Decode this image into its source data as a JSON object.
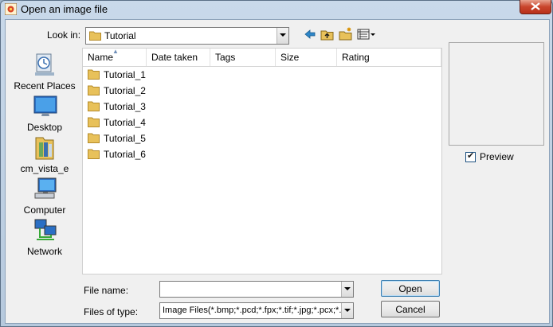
{
  "window": {
    "title": "Open an image file"
  },
  "look_in": {
    "label": "Look in:",
    "value": "Tutorial"
  },
  "toolbar_icons": [
    "back-arrow-icon",
    "up-folder-icon",
    "new-folder-icon",
    "view-menu-icon"
  ],
  "places": [
    {
      "label": "Recent Places",
      "icon": "recent-places-icon"
    },
    {
      "label": "Desktop",
      "icon": "desktop-icon"
    },
    {
      "label": "cm_vista_e",
      "icon": "user-folder-icon"
    },
    {
      "label": "Computer",
      "icon": "computer-icon"
    },
    {
      "label": "Network",
      "icon": "network-icon"
    }
  ],
  "columns": [
    "Name",
    "Date taken",
    "Tags",
    "Size",
    "Rating"
  ],
  "files": [
    "Tutorial_1",
    "Tutorial_2",
    "Tutorial_3",
    "Tutorial_4",
    "Tutorial_5",
    "Tutorial_6"
  ],
  "preview": {
    "label": "Preview",
    "checked": true
  },
  "file_name": {
    "label": "File name:",
    "value": ""
  },
  "files_of_type": {
    "label": "Files of type:",
    "value": "Image Files(*.bmp;*.pcd;*.fpx;*.tif;*.jpg;*.pcx;*.w"
  },
  "buttons": {
    "open": "Open",
    "cancel": "Cancel"
  },
  "colors": {
    "folder": "#e8c15a",
    "accent": "#3c7fb1"
  }
}
